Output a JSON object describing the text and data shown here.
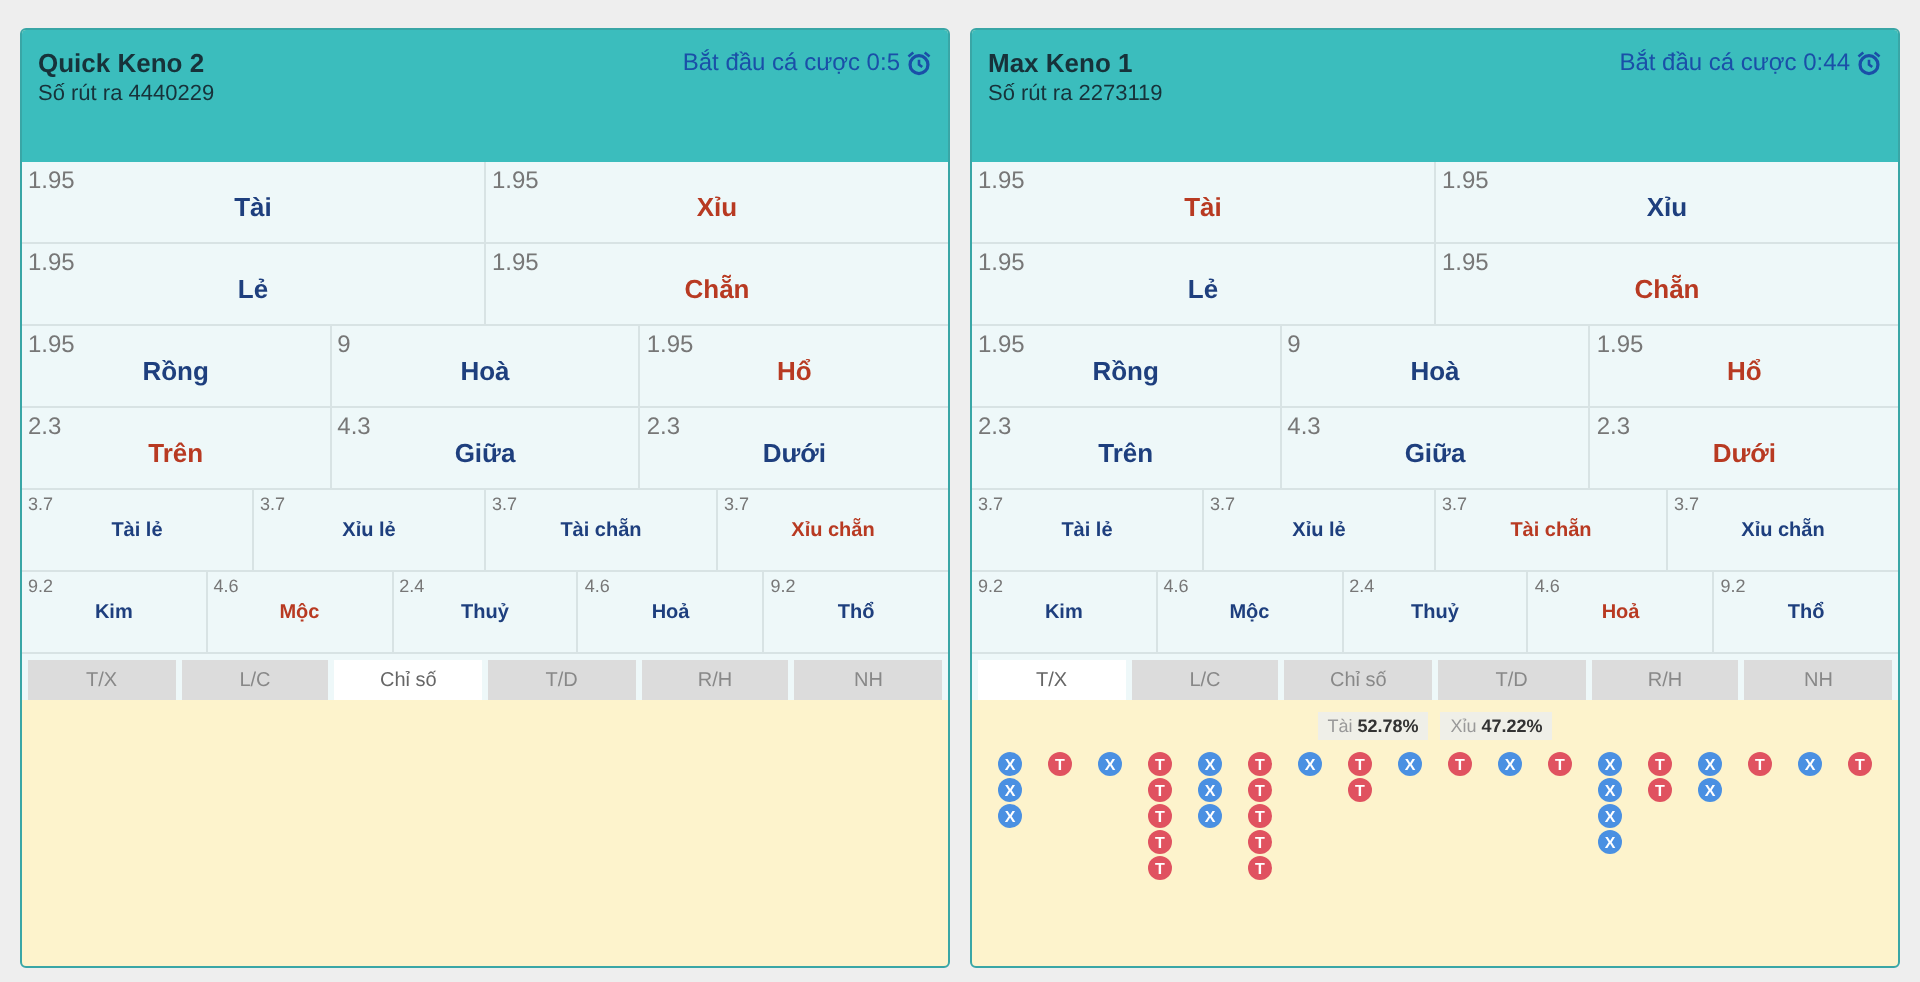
{
  "panels": [
    {
      "title": "Quick Keno 2",
      "draw": "Số rút ra 4440229",
      "countdown": "Bắt đầu cá cược 0:5",
      "bet_groups": [
        {
          "options": [
            {
              "odds": "1.95",
              "label": "Tài",
              "color": "#1e3f7e"
            },
            {
              "odds": "1.95",
              "label": "Xỉu",
              "color": "#b83a22"
            }
          ]
        },
        {
          "options": [
            {
              "odds": "1.95",
              "label": "Lẻ",
              "color": "#1e3f7e"
            },
            {
              "odds": "1.95",
              "label": "Chẵn",
              "color": "#b83a22"
            }
          ]
        },
        {
          "options": [
            {
              "odds": "1.95",
              "label": "Rồng",
              "color": "#1e3f7e"
            },
            {
              "odds": "9",
              "label": "Hoà",
              "color": "#1e3f7e"
            },
            {
              "odds": "1.95",
              "label": "Hổ",
              "color": "#b83a22"
            }
          ]
        },
        {
          "options": [
            {
              "odds": "2.3",
              "label": "Trên",
              "color": "#b83a22"
            },
            {
              "odds": "4.3",
              "label": "Giữa",
              "color": "#1e3f7e"
            },
            {
              "odds": "2.3",
              "label": "Dưới",
              "color": "#1e3f7e"
            }
          ]
        },
        {
          "options": [
            {
              "odds": "3.7",
              "label": "Tài lẻ",
              "color": "#1e3f7e"
            },
            {
              "odds": "3.7",
              "label": "Xỉu lẻ",
              "color": "#1e3f7e"
            },
            {
              "odds": "3.7",
              "label": "Tài chẵn",
              "color": "#1e3f7e"
            },
            {
              "odds": "3.7",
              "label": "Xỉu chẵn",
              "color": "#b83a22"
            }
          ]
        },
        {
          "options": [
            {
              "odds": "9.2",
              "label": "Kim",
              "color": "#1e3f7e"
            },
            {
              "odds": "4.6",
              "label": "Mộc",
              "color": "#b83a22"
            },
            {
              "odds": "2.4",
              "label": "Thuỷ",
              "color": "#1e3f7e"
            },
            {
              "odds": "4.6",
              "label": "Hoả",
              "color": "#1e3f7e"
            },
            {
              "odds": "9.2",
              "label": "Thổ",
              "color": "#1e3f7e"
            }
          ]
        }
      ],
      "tabs": [
        {
          "label": "T/X",
          "selected": false
        },
        {
          "label": "L/C",
          "selected": false
        },
        {
          "label": "Chỉ số",
          "selected": true
        },
        {
          "label": "T/D",
          "selected": false
        },
        {
          "label": "R/H",
          "selected": false
        },
        {
          "label": "NH",
          "selected": false
        }
      ]
    },
    {
      "title": "Max Keno 1",
      "draw": "Số rút ra 2273119",
      "countdown": "Bắt đầu cá cược 0:44",
      "bet_groups": [
        {
          "options": [
            {
              "odds": "1.95",
              "label": "Tài",
              "color": "#b83a22"
            },
            {
              "odds": "1.95",
              "label": "Xỉu",
              "color": "#1e3f7e"
            }
          ]
        },
        {
          "options": [
            {
              "odds": "1.95",
              "label": "Lẻ",
              "color": "#1e3f7e"
            },
            {
              "odds": "1.95",
              "label": "Chẵn",
              "color": "#b83a22"
            }
          ]
        },
        {
          "options": [
            {
              "odds": "1.95",
              "label": "Rồng",
              "color": "#1e3f7e"
            },
            {
              "odds": "9",
              "label": "Hoà",
              "color": "#1e3f7e"
            },
            {
              "odds": "1.95",
              "label": "Hổ",
              "color": "#b83a22"
            }
          ]
        },
        {
          "options": [
            {
              "odds": "2.3",
              "label": "Trên",
              "color": "#1e3f7e"
            },
            {
              "odds": "4.3",
              "label": "Giữa",
              "color": "#1e3f7e"
            },
            {
              "odds": "2.3",
              "label": "Dưới",
              "color": "#b83a22"
            }
          ]
        },
        {
          "options": [
            {
              "odds": "3.7",
              "label": "Tài lẻ",
              "color": "#1e3f7e"
            },
            {
              "odds": "3.7",
              "label": "Xỉu lẻ",
              "color": "#1e3f7e"
            },
            {
              "odds": "3.7",
              "label": "Tài chẵn",
              "color": "#b83a22"
            },
            {
              "odds": "3.7",
              "label": "Xỉu chẵn",
              "color": "#1e3f7e"
            }
          ]
        },
        {
          "options": [
            {
              "odds": "9.2",
              "label": "Kim",
              "color": "#1e3f7e"
            },
            {
              "odds": "4.6",
              "label": "Mộc",
              "color": "#1e3f7e"
            },
            {
              "odds": "2.4",
              "label": "Thuỷ",
              "color": "#1e3f7e"
            },
            {
              "odds": "4.6",
              "label": "Hoả",
              "color": "#b83a22"
            },
            {
              "odds": "9.2",
              "label": "Thổ",
              "color": "#1e3f7e"
            }
          ]
        }
      ],
      "tabs": [
        {
          "label": "T/X",
          "selected": true
        },
        {
          "label": "L/C",
          "selected": false
        },
        {
          "label": "Chỉ số",
          "selected": false
        },
        {
          "label": "T/D",
          "selected": false
        },
        {
          "label": "R/H",
          "selected": false
        },
        {
          "label": "NH",
          "selected": false
        }
      ],
      "stats": [
        "Tài **52.78%**",
        "Xỉu **47.22%**"
      ],
      "bead_columns": [
        [
          {
            "label": "X",
            "color": "#4a90e2"
          },
          {
            "label": "X",
            "color": "#4a90e2"
          },
          {
            "label": "X",
            "color": "#4a90e2"
          }
        ],
        [
          {
            "label": "T",
            "color": "#e05260"
          }
        ],
        [
          {
            "label": "X",
            "color": "#4a90e2"
          }
        ],
        [
          {
            "label": "T",
            "color": "#e05260"
          },
          {
            "label": "T",
            "color": "#e05260"
          },
          {
            "label": "T",
            "color": "#e05260"
          },
          {
            "label": "T",
            "color": "#e05260"
          },
          {
            "label": "T",
            "color": "#e05260"
          }
        ],
        [
          {
            "label": "X",
            "color": "#4a90e2"
          },
          {
            "label": "X",
            "color": "#4a90e2"
          },
          {
            "label": "X",
            "color": "#4a90e2"
          }
        ],
        [
          {
            "label": "T",
            "color": "#e05260"
          },
          {
            "label": "T",
            "color": "#e05260"
          },
          {
            "label": "T",
            "color": "#e05260"
          },
          {
            "label": "T",
            "color": "#e05260"
          },
          {
            "label": "T",
            "color": "#e05260"
          }
        ],
        [
          {
            "label": "X",
            "color": "#4a90e2"
          }
        ],
        [
          {
            "label": "T",
            "color": "#e05260"
          },
          {
            "label": "T",
            "color": "#e05260"
          }
        ],
        [
          {
            "label": "X",
            "color": "#4a90e2"
          }
        ],
        [
          {
            "label": "T",
            "color": "#e05260"
          }
        ],
        [
          {
            "label": "X",
            "color": "#4a90e2"
          }
        ],
        [
          {
            "label": "T",
            "color": "#e05260"
          }
        ],
        [
          {
            "label": "X",
            "color": "#4a90e2"
          },
          {
            "label": "X",
            "color": "#4a90e2"
          },
          {
            "label": "X",
            "color": "#4a90e2"
          },
          {
            "label": "X",
            "color": "#4a90e2"
          }
        ],
        [
          {
            "label": "T",
            "color": "#e05260"
          },
          {
            "label": "T",
            "color": "#e05260"
          }
        ],
        [
          {
            "label": "X",
            "color": "#4a90e2"
          },
          {
            "label": "X",
            "color": "#4a90e2"
          }
        ],
        [
          {
            "label": "T",
            "color": "#e05260"
          }
        ],
        [
          {
            "label": "X",
            "color": "#4a90e2"
          }
        ],
        [
          {
            "label": "T",
            "color": "#e05260"
          }
        ]
      ]
    }
  ]
}
